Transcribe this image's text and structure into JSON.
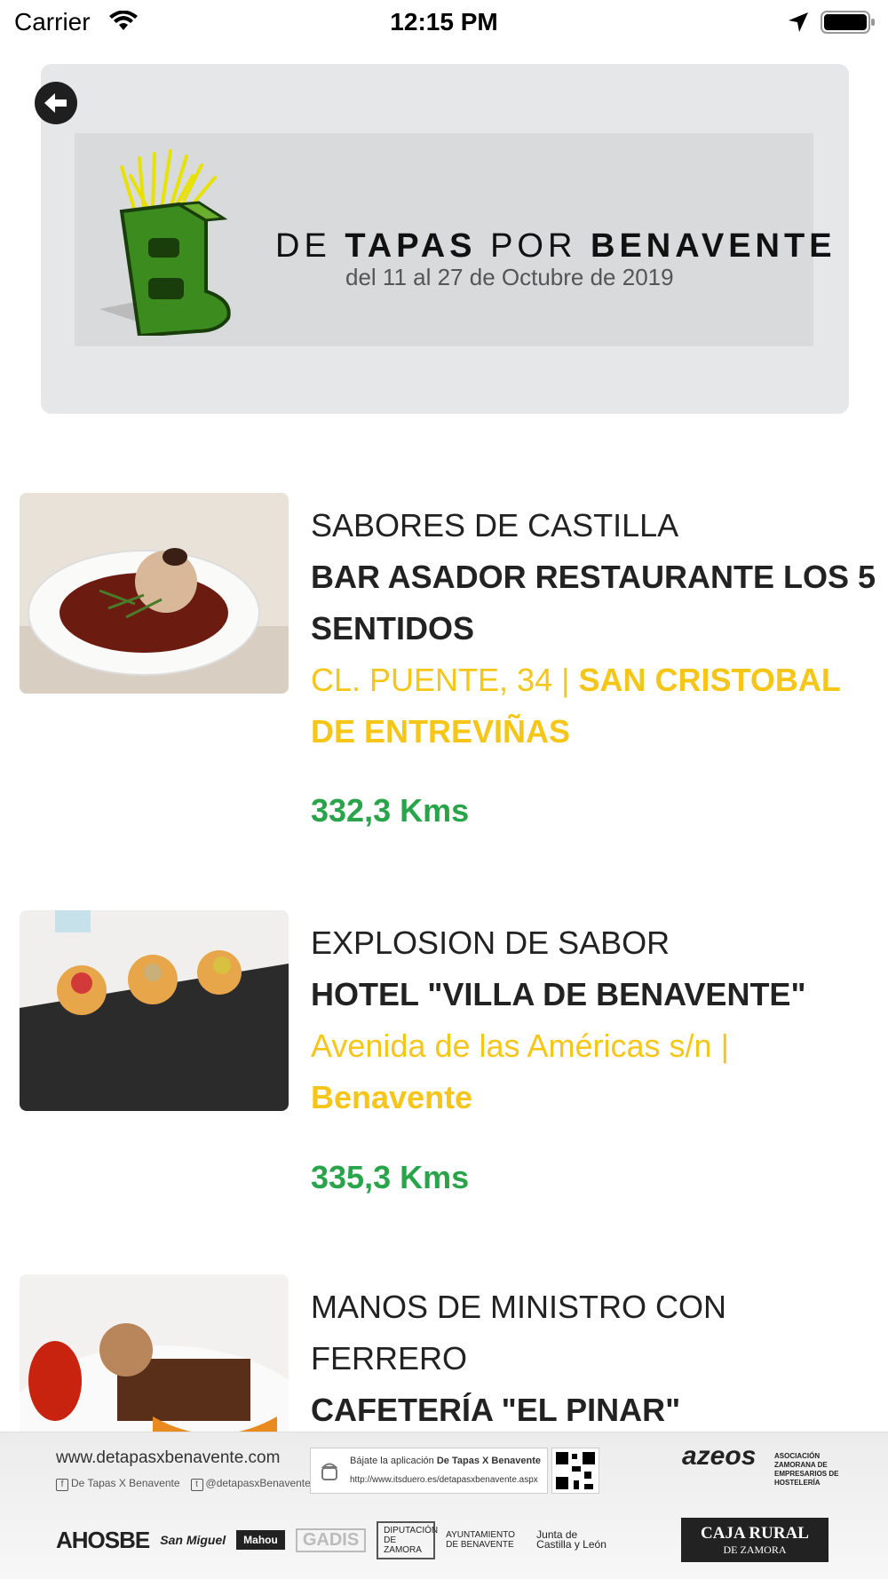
{
  "status_bar": {
    "carrier": "Carrier",
    "time": "12:15 PM"
  },
  "header": {
    "title_prefix": "DE",
    "title_bold1": "TAPAS",
    "title_mid": "POR",
    "title_bold2": "BENAVENTE",
    "subtitle": "del 11 al 27 de Octubre de 2019",
    "logo_letter": "B"
  },
  "items": [
    {
      "tapa_name": "SABORES DE CASTILLA",
      "venue": "BAR ASADOR RESTAURANTE LOS 5 SENTIDOS",
      "address": "CL. PUENTE, 34 |",
      "town": "SAN CRISTOBAL DE ENTREVIÑAS",
      "distance": "332,3 Kms"
    },
    {
      "tapa_name": "EXPLOSION DE SABOR",
      "venue": "HOTEL \"VILLA DE BENAVENTE\"",
      "address": "Avenida de las Américas s/n |",
      "town": "Benavente",
      "distance": "335,3 Kms"
    },
    {
      "tapa_name": "MANOS DE MINISTRO CON FERRERO",
      "venue": "CAFETERÍA \"EL PINAR\"",
      "address": "",
      "town": "",
      "distance": ""
    }
  ],
  "footer": {
    "website": "www.detapasxbenavente.com",
    "facebook": "De Tapas X Benavente",
    "twitter": "@detapasxBenavente",
    "app_text_prefix": "Bájate la aplicación",
    "app_text_bold": "De Tapas X Benavente",
    "app_url": "http://www.itsduero.es/detapasxbenavente.aspx",
    "azeos_name": "azeos",
    "azeos_desc": "ASOCIACIÓN ZAMORANA DE EMPRESARIOS DE HOSTELERÍA",
    "sponsors": [
      "AHOSBE",
      "San Miguel",
      "Mahou",
      "GADIS",
      "DIPUTACIÓN DE ZAMORA",
      "AYUNTAMIENTO DE BENAVENTE",
      "Junta de Castilla y León"
    ],
    "caja_rural_line1": "CAJA RURAL",
    "caja_rural_line2": "DE ZAMORA"
  },
  "colors": {
    "address_yellow": "#f5c518",
    "distance_green": "#2aa44a",
    "banner_bg": "#e5e7e9"
  }
}
